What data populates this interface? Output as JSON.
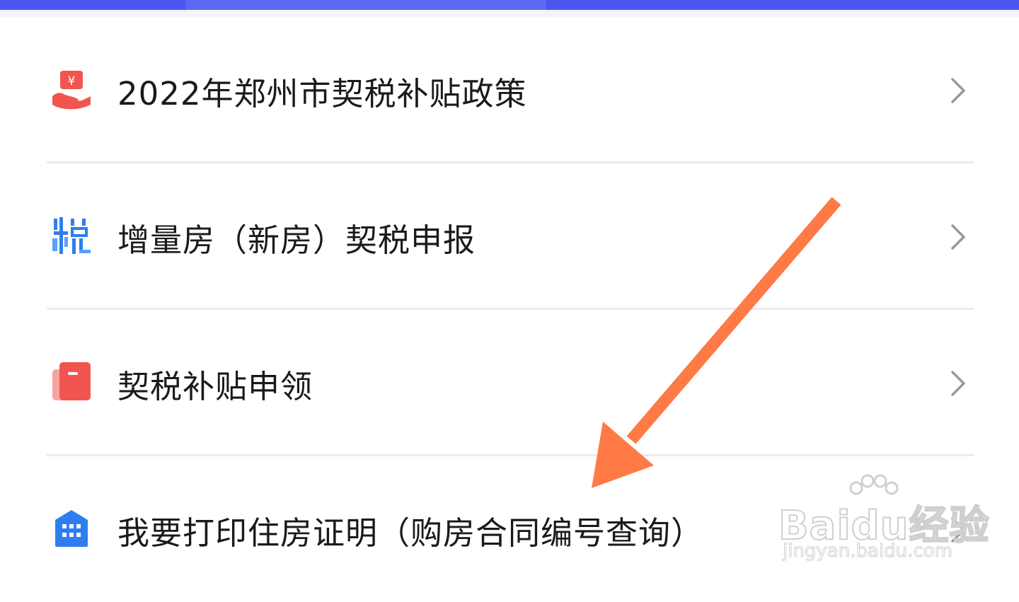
{
  "menu": {
    "items": [
      {
        "label": "2022年郑州市契税补贴政策",
        "icon": "red-hand-yuan-icon"
      },
      {
        "label": "增量房（新房）契税申报",
        "icon": "blue-tax-character-icon"
      },
      {
        "label": "契税补贴申领",
        "icon": "red-document-icon"
      },
      {
        "label": "我要打印住房证明（购房合同编号查询）",
        "icon": "blue-building-icon"
      }
    ]
  },
  "watermark": {
    "brand": "Baidu经验",
    "url": "jingyan.baidu.com"
  },
  "colors": {
    "top_bar": "#4b57f0",
    "arrow": "#ff7a45",
    "red_icon": "#f2554f",
    "blue_icon": "#2f7ef0"
  }
}
